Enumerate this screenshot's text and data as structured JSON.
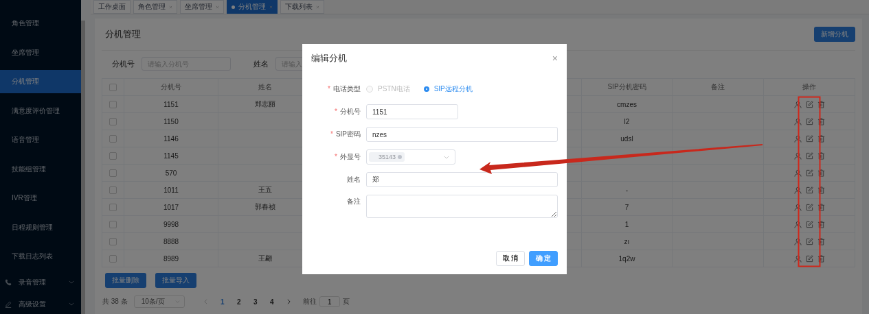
{
  "sidebar": {
    "items": [
      {
        "kind": "link",
        "label": "角色管理",
        "selected": false
      },
      {
        "kind": "link",
        "label": "坐席管理",
        "selected": false
      },
      {
        "kind": "link",
        "label": "分机管理",
        "selected": true
      },
      {
        "kind": "link",
        "label": "满意度评价管理",
        "selected": false
      },
      {
        "kind": "link",
        "label": "语音管理",
        "selected": false
      },
      {
        "kind": "link",
        "label": "技能组管理",
        "selected": false
      },
      {
        "kind": "link",
        "label": "IVR管理",
        "selected": false
      },
      {
        "kind": "link",
        "label": "日程规则管理",
        "selected": false
      },
      {
        "kind": "link",
        "label": "下载日志列表",
        "selected": false
      },
      {
        "kind": "submenu",
        "label": "录音管理",
        "selected": false
      },
      {
        "kind": "submenu",
        "label": "高级设置",
        "selected": false
      }
    ]
  },
  "tabs": [
    {
      "label": "工作桌面",
      "selected": false,
      "closable": false
    },
    {
      "label": "角色管理",
      "selected": false,
      "closable": true
    },
    {
      "label": "坐席管理",
      "selected": false,
      "closable": true
    },
    {
      "label": "分机管理",
      "selected": true,
      "closable": true
    },
    {
      "label": "下载列表",
      "selected": false,
      "closable": true
    }
  ],
  "page": {
    "title": "分机管理",
    "add_button": "新增分机",
    "filters": [
      {
        "label": "分机号",
        "placeholder": "请输入分机号"
      },
      {
        "label": "姓名",
        "placeholder": "请输入"
      }
    ]
  },
  "table": {
    "all_checked": false,
    "columns": [
      "分机号",
      "姓名",
      "SIP分机密码",
      "备注",
      "操作"
    ],
    "rows": [
      {
        "checked": false,
        "extension": "1151",
        "name": "郑志丽",
        "password": "cmzes"
      },
      {
        "checked": false,
        "extension": "1150",
        "password": "l2"
      },
      {
        "checked": false,
        "extension": "1146",
        "password": "udsl"
      },
      {
        "checked": false,
        "extension": "1145"
      },
      {
        "checked": false,
        "extension": "570"
      },
      {
        "checked": false,
        "extension": "1011",
        "name": "王五",
        "password": "-"
      },
      {
        "checked": false,
        "extension": "1017",
        "name": "郭春祯",
        "password": "7"
      },
      {
        "checked": false,
        "extension": "9998",
        "password": "1"
      },
      {
        "checked": false,
        "extension": "8888",
        "password": "zı"
      },
      {
        "checked": false,
        "extension": "8989",
        "name": "王翩",
        "password": "1q2w"
      }
    ]
  },
  "bulk_buttons": [
    "批量删除",
    "批量导入"
  ],
  "pagination": {
    "total": "共 38 条",
    "page_size": "10条/页",
    "pages": [
      {
        "label": "1",
        "selected": true
      },
      {
        "label": "2",
        "selected": false
      },
      {
        "label": "3",
        "selected": false
      },
      {
        "label": "4",
        "selected": false
      }
    ],
    "goto_label": "前往",
    "goto_value": "1",
    "goto_suffix": "页"
  },
  "modal": {
    "title": "编辑分机",
    "close": "×",
    "required_mark": "*",
    "fields": [
      {
        "kind": "radio",
        "label": "电话类型",
        "required": true,
        "options": [
          {
            "label": "PSTN电话",
            "selected": false,
            "disabled": true
          },
          {
            "label": "SIP远程分机",
            "selected": true,
            "disabled": false
          }
        ]
      },
      {
        "kind": "short_input",
        "label": "分机号",
        "required": true,
        "value": "1151"
      },
      {
        "kind": "input",
        "label": "SIP密码",
        "required": true,
        "value": "nzes"
      },
      {
        "kind": "select",
        "label": "外显号",
        "required": true,
        "tag": "35143"
      },
      {
        "kind": "input",
        "label": "姓名",
        "required": false,
        "value": "郑"
      },
      {
        "kind": "textarea",
        "label": "备注",
        "required": false
      }
    ],
    "buttons": [
      {
        "kind": "default",
        "label": "取 消"
      },
      {
        "kind": "primary",
        "label": "确 定"
      }
    ]
  }
}
